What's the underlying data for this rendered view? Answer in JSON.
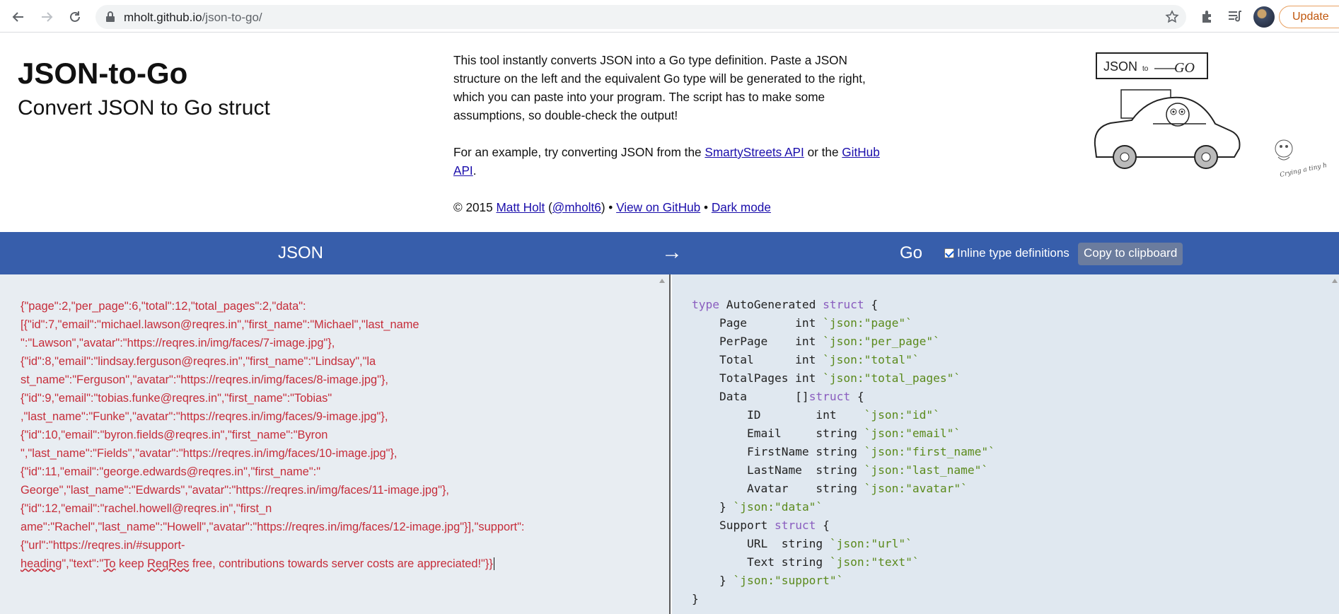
{
  "browser": {
    "url_host": "mholt.github.io",
    "url_path": "/json-to-go/",
    "update_label": "Update"
  },
  "header": {
    "title": "JSON-to-Go",
    "subtitle": "Convert JSON to Go struct",
    "description": "This tool instantly converts JSON into a Go type definition. Paste a JSON structure on the left and the equivalent Go type will be generated to the right, which you can paste into your program. The script has to make some assumptions, so double-check the output!",
    "example_prefix": "For an example, try converting JSON from the",
    "example_link1": "SmartyStreets API",
    "example_or": "or the",
    "example_link2": "GitHub API",
    "example_suffix": ".",
    "copyright": "© 2015",
    "author_link": "Matt Holt",
    "handle_open": "(",
    "handle_link": "@mholt6",
    "handle_close": ") •",
    "github_link": "View on GitHub",
    "sep": "•",
    "dark_mode_link": "Dark mode",
    "logo_text": "JSON",
    "logo_to": "to",
    "logo_go": "GO",
    "gopher_caption": "Crying a tiny hand"
  },
  "toolbar": {
    "json_label": "JSON",
    "arrow": "→",
    "go_label": "Go",
    "inline_label": "Inline type definitions",
    "copy_label": "Copy to clipboard"
  },
  "json_input": {
    "text_main": "{\"page\":2,\"per_page\":6,\"total\":12,\"total_pages\":2,\"data\":\n[{\"id\":7,\"email\":\"michael.lawson@reqres.in\",\"first_name\":\"Michael\",\"last_name\n\":\"Lawson\",\"avatar\":\"https://reqres.in/img/faces/7-image.jpg\"},\n{\"id\":8,\"email\":\"lindsay.ferguson@reqres.in\",\"first_name\":\"Lindsay\",\"la\nst_name\":\"Ferguson\",\"avatar\":\"https://reqres.in/img/faces/8-image.jpg\"},\n{\"id\":9,\"email\":\"tobias.funke@reqres.in\",\"first_name\":\"Tobias\"\n,\"last_name\":\"Funke\",\"avatar\":\"https://reqres.in/img/faces/9-image.jpg\"},\n{\"id\":10,\"email\":\"byron.fields@reqres.in\",\"first_name\":\"Byron\n\",\"last_name\":\"Fields\",\"avatar\":\"https://reqres.in/img/faces/10-image.jpg\"},\n{\"id\":11,\"email\":\"george.edwards@reqres.in\",\"first_name\":\"\nGeorge\",\"last_name\":\"Edwards\",\"avatar\":\"https://reqres.in/img/faces/11-image.jpg\"},\n{\"id\":12,\"email\":\"rachel.howell@reqres.in\",\"first_n\name\":\"Rachel\",\"last_name\":\"Howell\",\"avatar\":\"https://reqres.in/img/faces/12-image.jpg\"}],\"support\":\n{\"url\":\"https://reqres.in/#support-\n",
    "text_tail_a": "heading",
    "text_tail_b": "\",\"text\":\"",
    "text_tail_c": "To",
    "text_tail_d": " keep ",
    "text_tail_e": "ReqRes",
    "text_tail_f": " free, contributions towards server costs are appreciated!\"}}"
  },
  "go_output": {
    "lines": [
      [
        "type",
        " AutoGenerated ",
        "struct",
        " {"
      ],
      [
        "",
        "    Page       int ",
        "",
        "`json:\"page\"`"
      ],
      [
        "",
        "    PerPage    int ",
        "",
        "`json:\"per_page\"`"
      ],
      [
        "",
        "    Total      int ",
        "",
        "`json:\"total\"`"
      ],
      [
        "",
        "    TotalPages int ",
        "",
        "`json:\"total_pages\"`"
      ],
      [
        "",
        "    Data       []",
        "struct",
        " {"
      ],
      [
        "",
        "        ID        int    ",
        "",
        "`json:\"id\"`"
      ],
      [
        "",
        "        Email     string ",
        "",
        "`json:\"email\"`"
      ],
      [
        "",
        "        FirstName string ",
        "",
        "`json:\"first_name\"`"
      ],
      [
        "",
        "        LastName  string ",
        "",
        "`json:\"last_name\"`"
      ],
      [
        "",
        "        Avatar    string ",
        "",
        "`json:\"avatar\"`"
      ],
      [
        "",
        "    } ",
        "",
        "`json:\"data\"`"
      ],
      [
        "",
        "    Support ",
        "struct",
        " {"
      ],
      [
        "",
        "        URL  string ",
        "",
        "`json:\"url\"`"
      ],
      [
        "",
        "        Text string ",
        "",
        "`json:\"text\"`"
      ],
      [
        "",
        "    } ",
        "",
        "`json:\"support\"`"
      ],
      [
        "",
        "}",
        "",
        ""
      ]
    ]
  },
  "colors": {
    "bar": "#375eab",
    "json_text": "#c62d3a",
    "keyword": "#8a5dbf",
    "tag": "#5b8a1c"
  }
}
